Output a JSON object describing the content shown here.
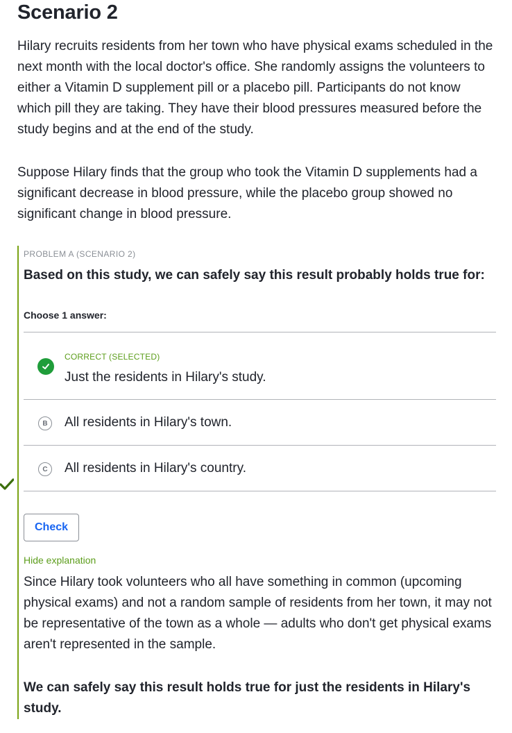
{
  "scenario": {
    "title": "Scenario 2",
    "paragraph1": "Hilary recruits residents from her town who have physical exams scheduled in the next month with the local doctor's office. She randomly assigns the volunteers to either a Vitamin D supplement pill or a placebo pill. Participants do not know which pill they are taking. They have their blood pressures measured before the study begins and at the end of the study.",
    "paragraph2": "Suppose Hilary finds that the group who took the Vitamin D supplements had a significant decrease in blood pressure, while the placebo group showed no significant change in blood pressure."
  },
  "problem": {
    "label": "PROBLEM A (SCENARIO 2)",
    "question": "Based on this study, we can safely say this result probably holds true for:",
    "choose_label": "Choose 1 answer:",
    "choices": [
      {
        "status": "CORRECT (SELECTED)",
        "text": "Just the residents in Hilary's study."
      },
      {
        "letter": "B",
        "text": "All residents in Hilary's town."
      },
      {
        "letter": "C",
        "text": "All residents in Hilary's country."
      }
    ],
    "check_label": "Check",
    "hide_explanation_label": "Hide explanation",
    "explanation": "Since Hilary took volunteers who all have something in common (upcoming physical exams) and not a random sample of residents from her town, it may not be representative of the town as a whole — adults who don't get physical exams aren't represented in the sample.",
    "conclusion": "We can safely say this result holds true for just the residents in Hilary's study."
  },
  "colors": {
    "accent_green": "#7aa314",
    "correct_green": "#1f9d3a",
    "link_blue": "#1865f2",
    "side_check": "#3b6e0b"
  },
  "icons": [
    "checkmark-icon",
    "side-checkmark-icon",
    "letter-b-icon",
    "letter-c-icon"
  ]
}
